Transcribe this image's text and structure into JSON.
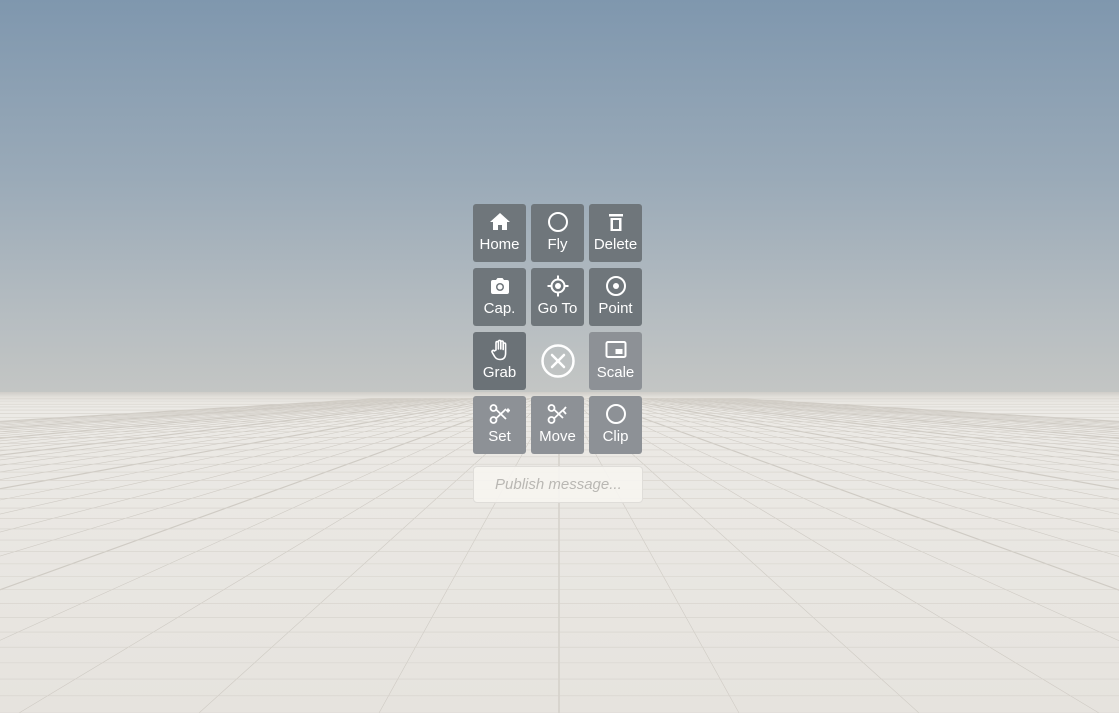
{
  "colors": {
    "tile_dark": "#6f767b",
    "tile_light": "#8d9196",
    "label": "#ffffff",
    "sky_top": "#7f97ae",
    "floor": "#e6e3de"
  },
  "menu": {
    "buttons": [
      {
        "label": "Home",
        "icon": "home-icon"
      },
      {
        "label": "Fly",
        "icon": "circle-icon"
      },
      {
        "label": "Delete",
        "icon": "trash-icon"
      },
      {
        "label": "Cap.",
        "icon": "camera-icon"
      },
      {
        "label": "Go To",
        "icon": "crosshair-icon"
      },
      {
        "label": "Point",
        "icon": "target-icon"
      },
      {
        "label": "Grab",
        "icon": "hand-icon"
      },
      {
        "label": "",
        "icon": "close-circle-icon"
      },
      {
        "label": "Scale",
        "icon": "picture-in-picture-icon"
      },
      {
        "label": "Set",
        "icon": "scissors-plus-icon"
      },
      {
        "label": "Move",
        "icon": "scissors-arrow-icon"
      },
      {
        "label": "Clip",
        "icon": "circle-icon"
      }
    ]
  },
  "publish": {
    "placeholder": "Publish message..."
  }
}
